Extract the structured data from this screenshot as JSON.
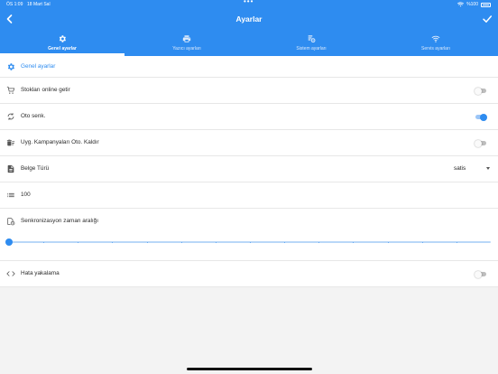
{
  "status_bar": {
    "time": "ÖS 1:09",
    "date": "18 Mart Sal",
    "battery": "%100"
  },
  "header": {
    "title": "Ayarlar"
  },
  "tabs": [
    {
      "label": "Genel ayarlar",
      "icon": "gear-icon",
      "active": true
    },
    {
      "label": "Yazıcı ayarları",
      "icon": "printer-icon",
      "active": false
    },
    {
      "label": "Sistem ayarları",
      "icon": "system-settings-icon",
      "active": false
    },
    {
      "label": "Servis ayarları",
      "icon": "wifi-icon",
      "active": false
    }
  ],
  "settings": {
    "section_title": "Genel ayarlar",
    "stock_online": {
      "label": "Stokları online getir",
      "value": false
    },
    "auto_sync": {
      "label": "Oto senk.",
      "value": true
    },
    "remove_campaigns": {
      "label": "Uyg. Kampanyaları Oto. Kaldır",
      "value": false
    },
    "document_type": {
      "label": "Belge Türü",
      "value": "satis"
    },
    "count": {
      "value": "100"
    },
    "sync_interval": {
      "label": "Senkronizasyon zaman aralığı",
      "slider_fraction": 0
    },
    "error_catch": {
      "label": "Hata yakalama",
      "value": false
    }
  },
  "colors": {
    "accent": "#2e8cf0",
    "background": "#f3f3f3",
    "row": "#ffffff"
  }
}
